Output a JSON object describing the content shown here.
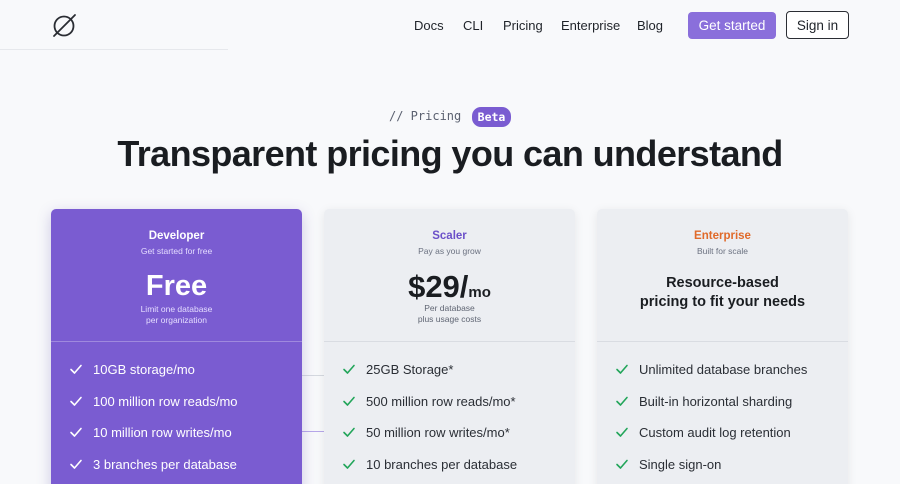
{
  "nav": {
    "logo_icon": "slashed-circle-logo-icon",
    "links": [
      "Docs",
      "CLI",
      "Pricing",
      "Enterprise",
      "Blog"
    ],
    "get_started": "Get started",
    "sign_in": "Sign in"
  },
  "hero": {
    "eyebrow": "// Pricing",
    "badge": "Beta",
    "title": "Transparent pricing you can understand"
  },
  "colors": {
    "brand_purple": "#7a5cd1",
    "button_purple": "#8a6fdb",
    "enterprise_orange": "#e06a2a",
    "check_green": "#22a55a"
  },
  "plans": {
    "developer": {
      "name": "Developer",
      "subtitle": "Get started for free",
      "price": "Free",
      "note_line1": "Limit one database",
      "note_line2": "per organization",
      "features": [
        "10GB storage/mo",
        "100 million row reads/mo",
        "10 million row writes/mo",
        "3 branches per database"
      ]
    },
    "scaler": {
      "name": "Scaler",
      "subtitle": "Pay as you grow",
      "price": "$29/",
      "period": "mo",
      "note_line1": "Per database",
      "note_line2": "plus usage costs",
      "features": [
        "25GB Storage*",
        "500 million row reads/mo*",
        "50 million row writes/mo*",
        "10 branches per database"
      ]
    },
    "enterprise": {
      "name": "Enterprise",
      "subtitle": "Built for scale",
      "desc_line1": "Resource-based",
      "desc_line2": "pricing to fit your needs",
      "features": [
        "Unlimited database branches",
        "Built-in horizontal sharding",
        "Custom audit log retention",
        "Single sign-on"
      ]
    }
  }
}
